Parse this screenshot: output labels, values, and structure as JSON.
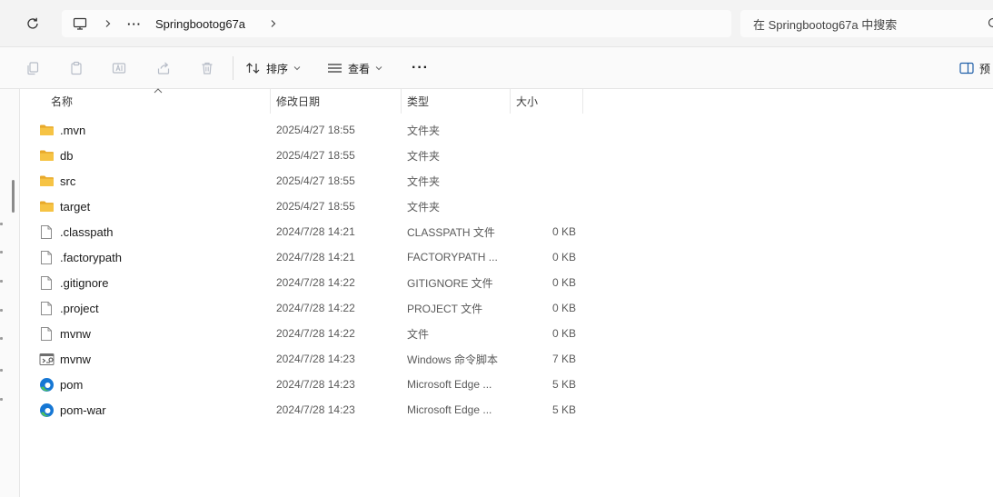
{
  "address_bar": {
    "breadcrumb_more": "···",
    "current_folder": "Springbootog67a",
    "search_placeholder": "在 Springbootog67a 中搜索"
  },
  "toolbar": {
    "sort_label": "排序",
    "view_label": "查看",
    "more_label": "···",
    "preview_label": "预"
  },
  "columns": {
    "name": "名称",
    "date": "修改日期",
    "type": "类型",
    "size": "大小"
  },
  "files": [
    {
      "name": ".mvn",
      "date": "2025/4/27 18:55",
      "type": "文件夹",
      "size": "",
      "icon": "folder-icon"
    },
    {
      "name": "db",
      "date": "2025/4/27 18:55",
      "type": "文件夹",
      "size": "",
      "icon": "folder-icon"
    },
    {
      "name": "src",
      "date": "2025/4/27 18:55",
      "type": "文件夹",
      "size": "",
      "icon": "folder-icon"
    },
    {
      "name": "target",
      "date": "2025/4/27 18:55",
      "type": "文件夹",
      "size": "",
      "icon": "folder-icon"
    },
    {
      "name": ".classpath",
      "date": "2024/7/28 14:21",
      "type": "CLASSPATH 文件",
      "size": "0 KB",
      "icon": "file-icon"
    },
    {
      "name": ".factorypath",
      "date": "2024/7/28 14:21",
      "type": "FACTORYPATH ...",
      "size": "0 KB",
      "icon": "file-icon"
    },
    {
      "name": ".gitignore",
      "date": "2024/7/28 14:22",
      "type": "GITIGNORE 文件",
      "size": "0 KB",
      "icon": "file-icon"
    },
    {
      "name": ".project",
      "date": "2024/7/28 14:22",
      "type": "PROJECT 文件",
      "size": "0 KB",
      "icon": "file-icon"
    },
    {
      "name": "mvnw",
      "date": "2024/7/28 14:22",
      "type": "文件",
      "size": "0 KB",
      "icon": "file-icon"
    },
    {
      "name": "mvnw",
      "date": "2024/7/28 14:23",
      "type": "Windows 命令脚本",
      "size": "7 KB",
      "icon": "script-icon"
    },
    {
      "name": "pom",
      "date": "2024/7/28 14:23",
      "type": "Microsoft Edge ...",
      "size": "5 KB",
      "icon": "edge-icon"
    },
    {
      "name": "pom-war",
      "date": "2024/7/28 14:23",
      "type": "Microsoft Edge ...",
      "size": "5 KB",
      "icon": "edge-icon"
    }
  ],
  "colors": {
    "folder": "#f6c344",
    "folder_dark": "#e8a92a",
    "edge_blue": "#1677d4",
    "edge_green": "#4fc35a"
  }
}
